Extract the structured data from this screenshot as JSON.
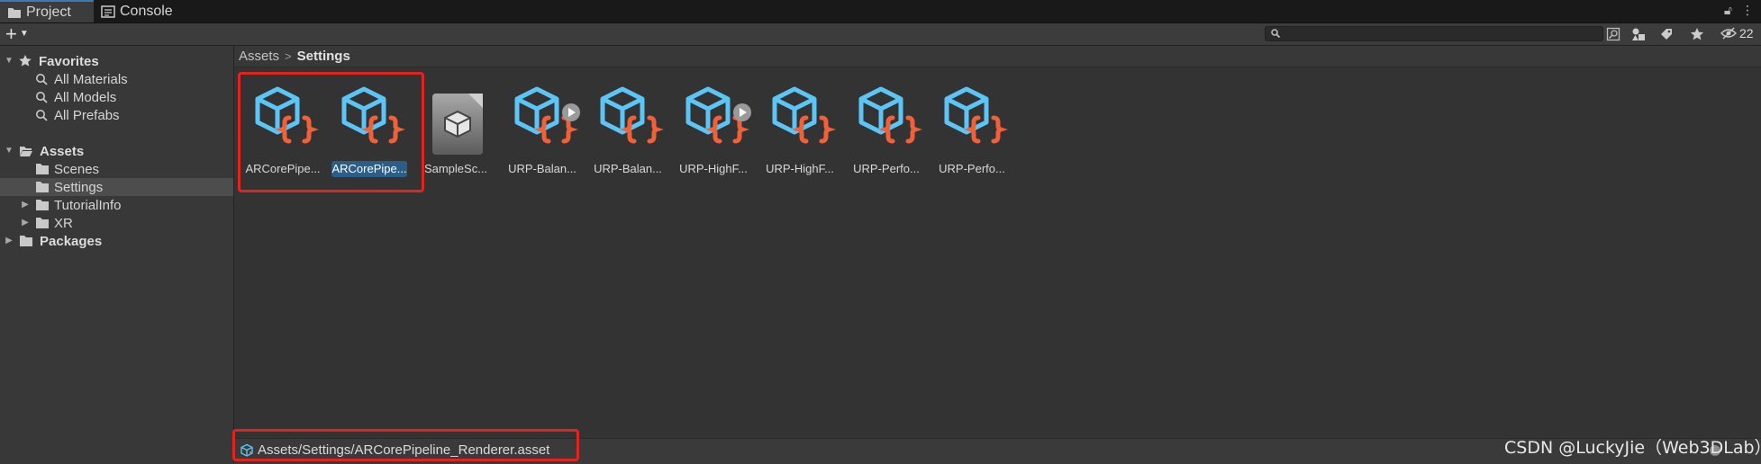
{
  "tabs": [
    {
      "label": "Project",
      "icon": "folder-icon",
      "active": true
    },
    {
      "label": "Console",
      "icon": "console-icon",
      "active": false
    }
  ],
  "toolbar": {
    "add_label": "+",
    "search_value": "",
    "search_placeholder": "",
    "hidden_packages_count": "22"
  },
  "sidebar": {
    "favorites": {
      "label": "Favorites",
      "items": [
        "All Materials",
        "All Models",
        "All Prefabs"
      ]
    },
    "assets": {
      "label": "Assets",
      "items": [
        {
          "label": "Scenes",
          "expandable": false,
          "selected": false
        },
        {
          "label": "Settings",
          "expandable": false,
          "selected": true
        },
        {
          "label": "TutorialInfo",
          "expandable": true,
          "selected": false
        },
        {
          "label": "XR",
          "expandable": true,
          "selected": false
        }
      ]
    },
    "packages": {
      "label": "Packages"
    }
  },
  "breadcrumb": {
    "root": "Assets",
    "separator": ">",
    "current": "Settings"
  },
  "assets": [
    {
      "name": "ARCorePipe...",
      "kind": "pipeline-asset",
      "selected": false,
      "play_badge": false
    },
    {
      "name": "ARCorePipe...",
      "kind": "pipeline-asset",
      "selected": true,
      "play_badge": false
    },
    {
      "name": "SampleSc...",
      "kind": "scene-template",
      "selected": false,
      "play_badge": false
    },
    {
      "name": "URP-Balan...",
      "kind": "pipeline-asset",
      "selected": false,
      "play_badge": true
    },
    {
      "name": "URP-Balan...",
      "kind": "pipeline-asset",
      "selected": false,
      "play_badge": false
    },
    {
      "name": "URP-HighF...",
      "kind": "pipeline-asset",
      "selected": false,
      "play_badge": true
    },
    {
      "name": "URP-HighF...",
      "kind": "pipeline-asset",
      "selected": false,
      "play_badge": false
    },
    {
      "name": "URP-Perfo...",
      "kind": "pipeline-asset",
      "selected": false,
      "play_badge": false
    },
    {
      "name": "URP-Perfo...",
      "kind": "pipeline-asset",
      "selected": false,
      "play_badge": false
    }
  ],
  "status": {
    "path": "Assets/Settings/ARCorePipeline_Renderer.asset"
  },
  "watermark": "CSDN @LuckyJie（Web3DLab）",
  "colors": {
    "accent": "#3a79bb",
    "cube_blue": "#5cc5f5",
    "brace_orange": "#f0613a",
    "highlight_red": "#e0241f",
    "selection": "#2c5d87"
  }
}
